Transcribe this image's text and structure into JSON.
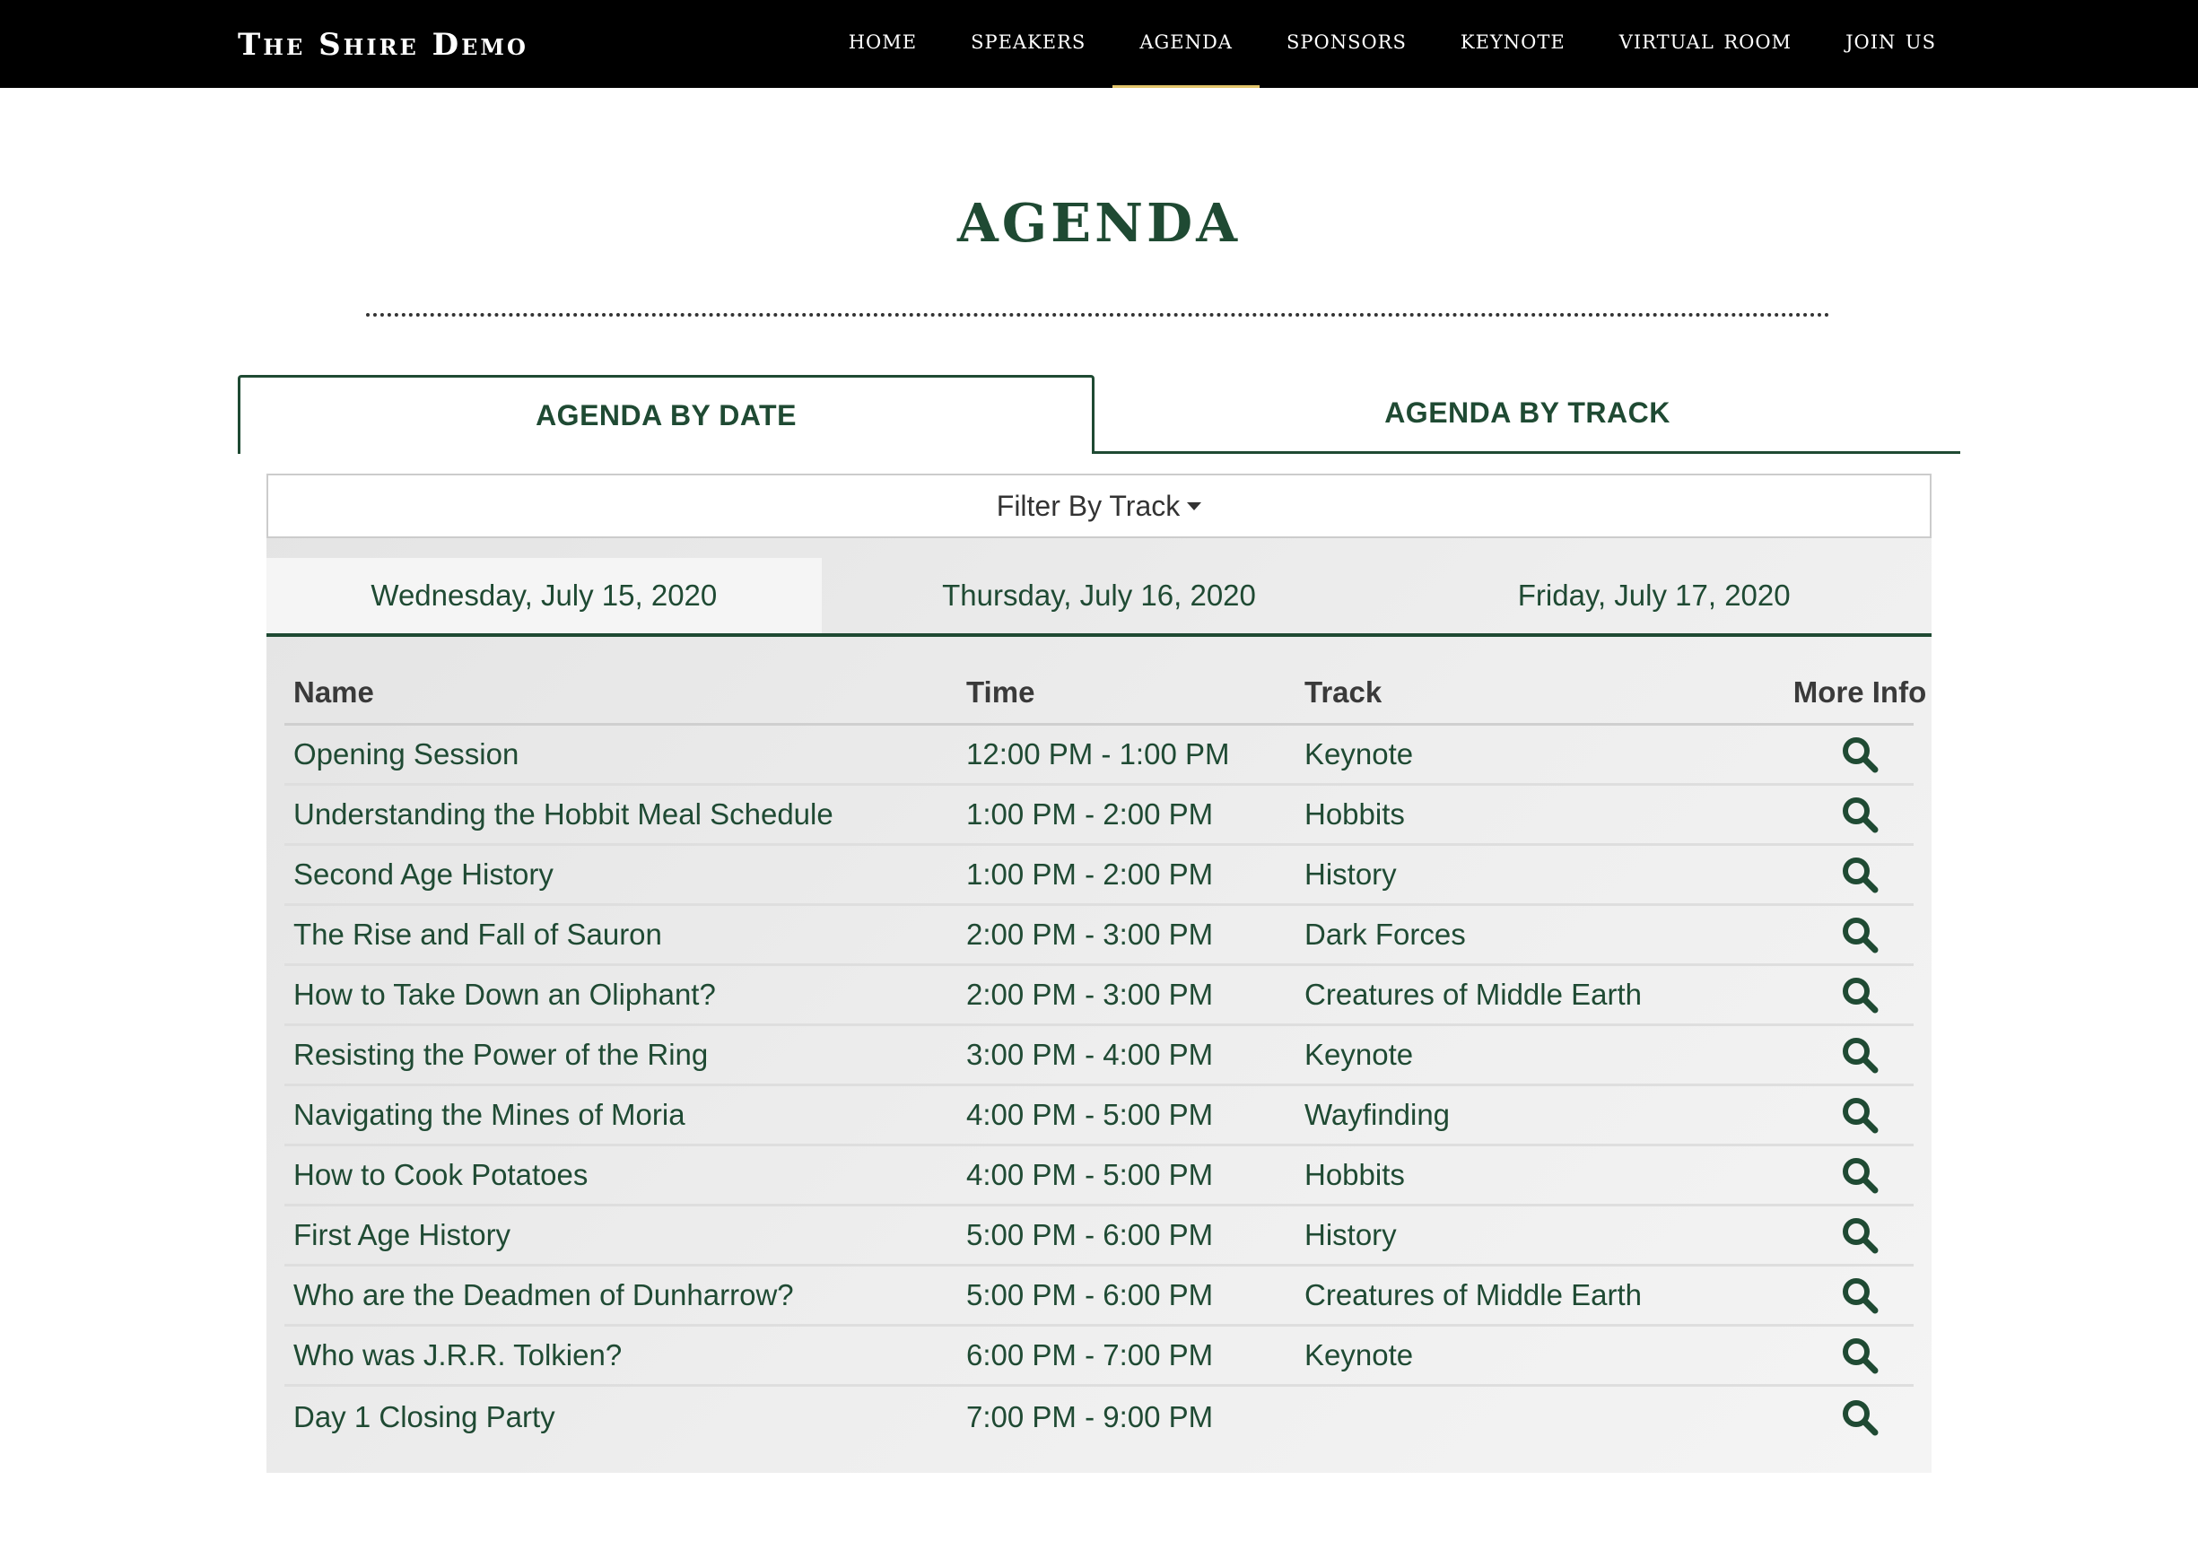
{
  "brand": "The Shire Demo",
  "nav": [
    {
      "label": "home",
      "active": false
    },
    {
      "label": "speakers",
      "active": false
    },
    {
      "label": "agenda",
      "active": true
    },
    {
      "label": "sponsors",
      "active": false
    },
    {
      "label": "keynote",
      "active": false
    },
    {
      "label": "virtual room",
      "active": false
    },
    {
      "label": "join us",
      "active": false
    }
  ],
  "page_title": "Agenda",
  "view_tabs": {
    "by_date": "AGENDA BY DATE",
    "by_track": "AGENDA BY TRACK",
    "active": "by_date"
  },
  "filter": {
    "label": "Filter By Track"
  },
  "days": [
    {
      "label": "Wednesday, July 15, 2020",
      "active": true
    },
    {
      "label": "Thursday, July 16, 2020",
      "active": false
    },
    {
      "label": "Friday, July 17, 2020",
      "active": false
    }
  ],
  "table": {
    "headers": {
      "name": "Name",
      "time": "Time",
      "track": "Track",
      "info": "More Info"
    },
    "rows": [
      {
        "name": "Opening Session",
        "time": "12:00 PM - 1:00 PM",
        "track": "Keynote"
      },
      {
        "name": "Understanding the Hobbit Meal Schedule",
        "time": "1:00 PM - 2:00 PM",
        "track": "Hobbits"
      },
      {
        "name": "Second Age History",
        "time": "1:00 PM - 2:00 PM",
        "track": "History"
      },
      {
        "name": "The Rise and Fall of Sauron",
        "time": "2:00 PM - 3:00 PM",
        "track": "Dark Forces"
      },
      {
        "name": "How to Take Down an Oliphant?",
        "time": "2:00 PM - 3:00 PM",
        "track": "Creatures of Middle Earth"
      },
      {
        "name": "Resisting the Power of the Ring",
        "time": "3:00 PM - 4:00 PM",
        "track": "Keynote"
      },
      {
        "name": "Navigating the Mines of Moria",
        "time": "4:00 PM - 5:00 PM",
        "track": "Wayfinding"
      },
      {
        "name": "How to Cook Potatoes",
        "time": "4:00 PM - 5:00 PM",
        "track": "Hobbits"
      },
      {
        "name": "First Age History",
        "time": "5:00 PM - 6:00 PM",
        "track": "History"
      },
      {
        "name": "Who are the Deadmen of Dunharrow?",
        "time": "5:00 PM - 6:00 PM",
        "track": "Creatures of Middle Earth"
      },
      {
        "name": "Who was J.R.R. Tolkien?",
        "time": "6:00 PM - 7:00 PM",
        "track": "Keynote"
      },
      {
        "name": "Day 1 Closing Party",
        "time": "7:00 PM - 9:00 PM",
        "track": ""
      }
    ],
    "info_icon": "magnifier-icon"
  },
  "colors": {
    "brand_green": "#1f4a33",
    "nav_background": "#000000",
    "nav_active_underline": "#e3c56b",
    "panel_background": "#ececec"
  }
}
